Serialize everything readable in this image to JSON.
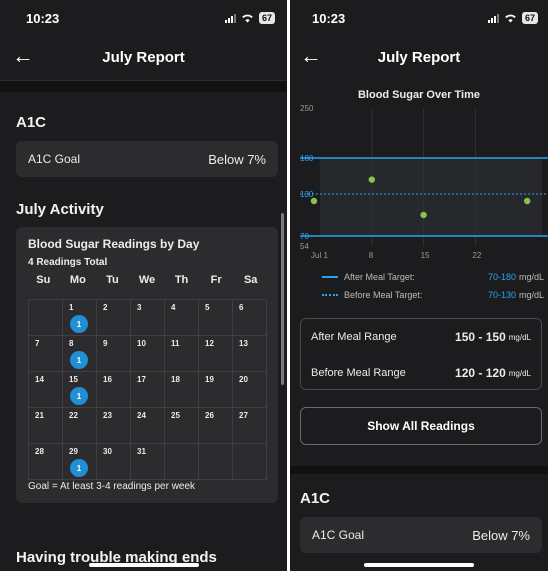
{
  "status": {
    "time": "10:23",
    "battery": "67"
  },
  "nav": {
    "title": "July Report"
  },
  "a1c": {
    "heading": "A1C",
    "goal_label": "A1C Goal",
    "goal_value": "Below 7%"
  },
  "activity": {
    "heading": "July Activity",
    "calendar_title": "Blood Sugar Readings by Day",
    "total": "4 Readings Total",
    "days_of_week": [
      "Su",
      "Mo",
      "Tu",
      "We",
      "Th",
      "Fr",
      "Sa"
    ],
    "weeks": [
      [
        "",
        "1",
        "2",
        "3",
        "4",
        "5",
        "6"
      ],
      [
        "7",
        "8",
        "9",
        "10",
        "11",
        "12",
        "13"
      ],
      [
        "14",
        "15",
        "16",
        "17",
        "18",
        "19",
        "20"
      ],
      [
        "21",
        "22",
        "23",
        "24",
        "25",
        "26",
        "27"
      ],
      [
        "28",
        "29",
        "30",
        "31",
        "",
        "",
        ""
      ]
    ],
    "reading_counts": {
      "1": "1",
      "8": "1",
      "15": "1",
      "29": "1"
    },
    "goal_note": "Goal = At least 3-4 readings per week"
  },
  "footer_heading": "Having trouble making ends",
  "chart_data": {
    "type": "scatter",
    "title": "Blood Sugar Over Time",
    "y_ticks": [
      "250",
      "180",
      "130",
      "70",
      "54"
    ],
    "x_ticks": [
      "Jul 1",
      "8",
      "15",
      "22"
    ],
    "ylim": [
      54,
      250
    ],
    "xlim": [
      1,
      31
    ],
    "grid": true,
    "points": [
      {
        "x": 1,
        "y": 120
      },
      {
        "x": 8,
        "y": 150
      },
      {
        "x": 15,
        "y": 100
      },
      {
        "x": 29,
        "y": 120
      }
    ],
    "after_meal_target": [
      70,
      180
    ],
    "before_meal_target": [
      70,
      130
    ],
    "legend": [
      {
        "label": "After Meal Target:",
        "low": "70",
        "high": "180",
        "unit": "mg/dL",
        "style": "solid"
      },
      {
        "label": "Before Meal Target:",
        "low": "70",
        "high": "130",
        "unit": "mg/dL",
        "style": "dotted"
      }
    ],
    "colors": {
      "target_line": "#29a3f0",
      "point": "#8bc34a",
      "band": "#26282b"
    }
  },
  "ranges": {
    "after_label": "After Meal Range",
    "after_value": "150 - 150",
    "before_label": "Before Meal Range",
    "before_value": "120 - 120",
    "unit": "mg/dL"
  },
  "show_all_label": "Show All Readings"
}
